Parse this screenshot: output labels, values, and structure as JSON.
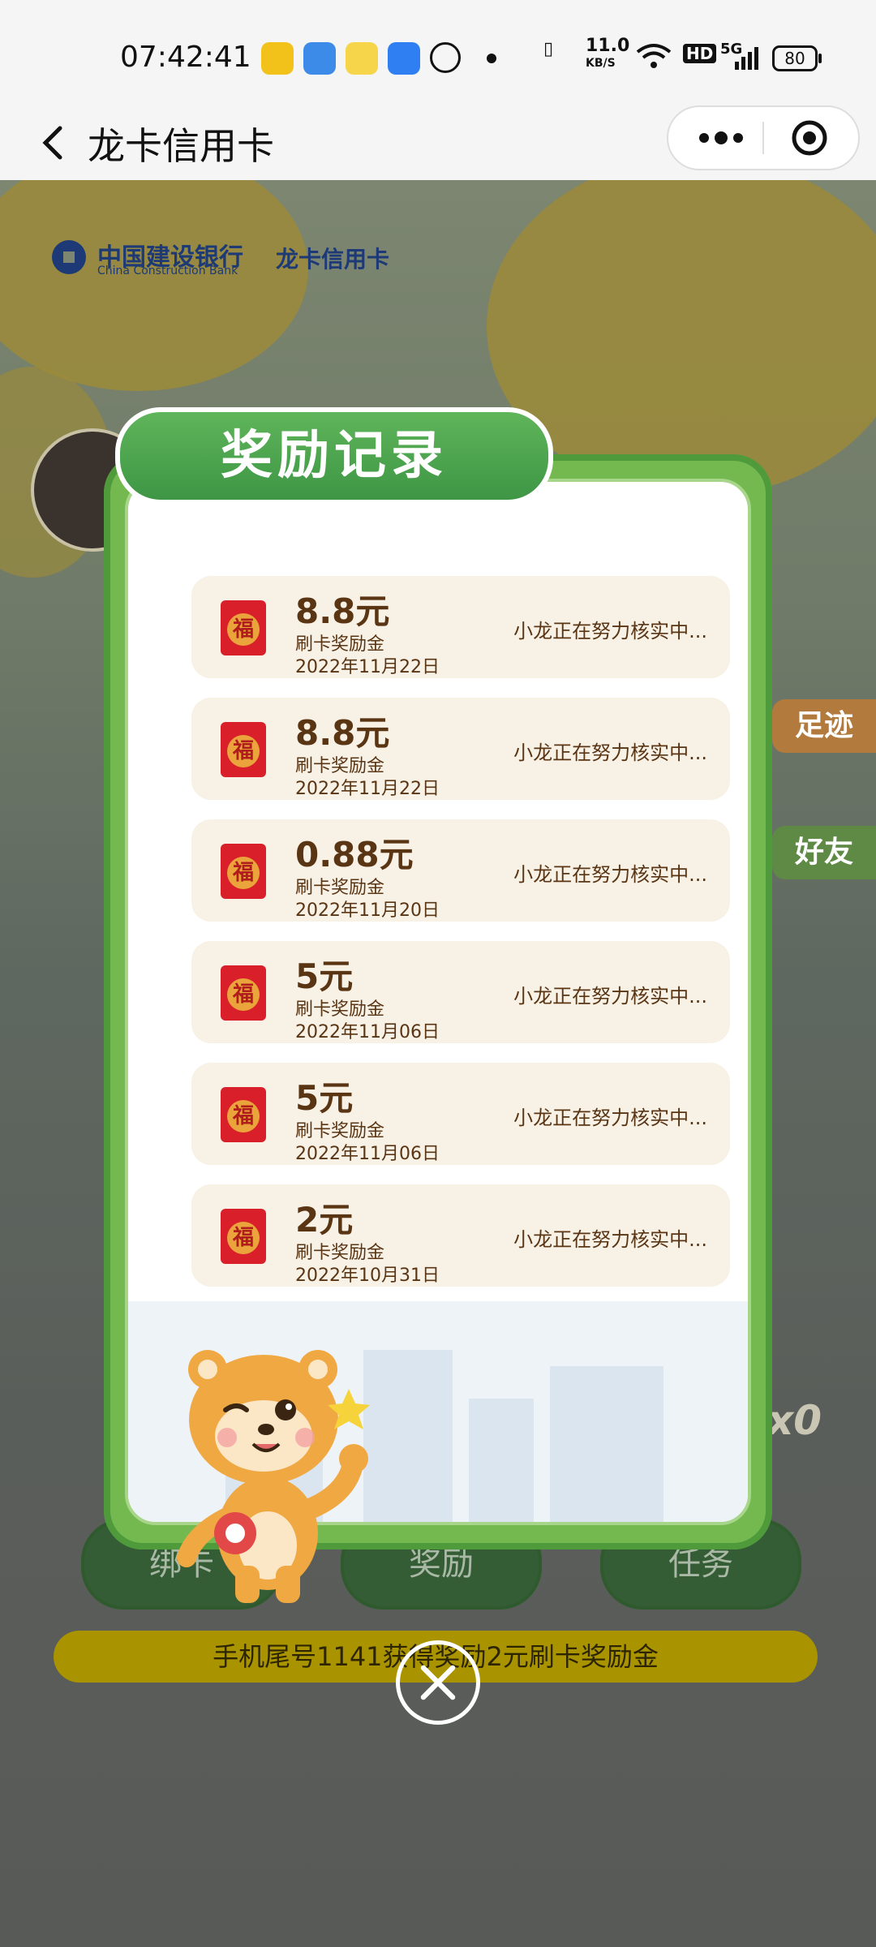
{
  "status_bar": {
    "time": "07:42:41",
    "net_speed": "11.0",
    "net_unit": "KB/S",
    "hd": "HD",
    "signal": "5G",
    "battery": "80"
  },
  "nav": {
    "title": "龙卡信用卡"
  },
  "bank": {
    "name_cn": "中国建设银行",
    "name_en": "China Construction Bank",
    "product": "龙卡信用卡"
  },
  "scene": {
    "side_tabs": [
      "足迹",
      "好友"
    ],
    "bottom_nav": [
      "绑卡",
      "奖励",
      "任务"
    ],
    "ticker": "手机尾号1141获得奖励2元刷卡奖励金",
    "counter": "x0"
  },
  "modal": {
    "title": "奖励记录",
    "records": [
      {
        "amount": "8.8元",
        "type": "刷卡奖励金",
        "date": "2022年11月22日",
        "status": "小龙正在努力核实中..."
      },
      {
        "amount": "8.8元",
        "type": "刷卡奖励金",
        "date": "2022年11月22日",
        "status": "小龙正在努力核实中..."
      },
      {
        "amount": "0.88元",
        "type": "刷卡奖励金",
        "date": "2022年11月20日",
        "status": "小龙正在努力核实中..."
      },
      {
        "amount": "5元",
        "type": "刷卡奖励金",
        "date": "2022年11月06日",
        "status": "小龙正在努力核实中..."
      },
      {
        "amount": "5元",
        "type": "刷卡奖励金",
        "date": "2022年11月06日",
        "status": "小龙正在努力核实中..."
      },
      {
        "amount": "2元",
        "type": "刷卡奖励金",
        "date": "2022年10月31日",
        "status": "小龙正在努力核实中..."
      }
    ],
    "fu_char": "福"
  },
  "colors": {
    "accent_green": "#3e9645",
    "text_brown": "#5a3514",
    "envelope_red": "#d81f2a"
  }
}
